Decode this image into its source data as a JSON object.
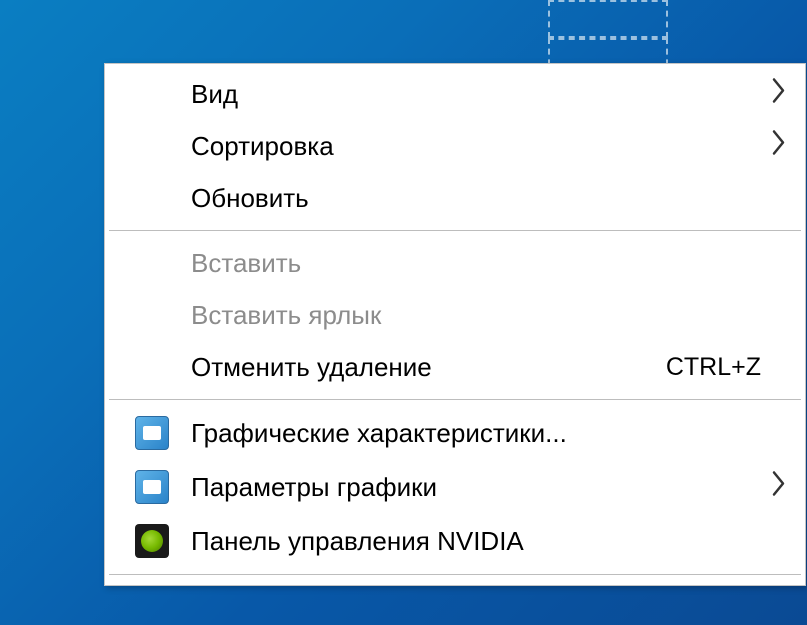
{
  "menu": {
    "view": {
      "label": "Вид"
    },
    "sort": {
      "label": "Сортировка"
    },
    "refresh": {
      "label": "Обновить"
    },
    "paste": {
      "label": "Вставить"
    },
    "paste_shortcut": {
      "label": "Вставить ярлык"
    },
    "undo_delete": {
      "label": "Отменить удаление",
      "shortcut": "CTRL+Z"
    },
    "graphics_props": {
      "label": "Графические характеристики..."
    },
    "graphics_params": {
      "label": "Параметры графики"
    },
    "nvidia_panel": {
      "label": "Панель управления NVIDIA"
    }
  }
}
